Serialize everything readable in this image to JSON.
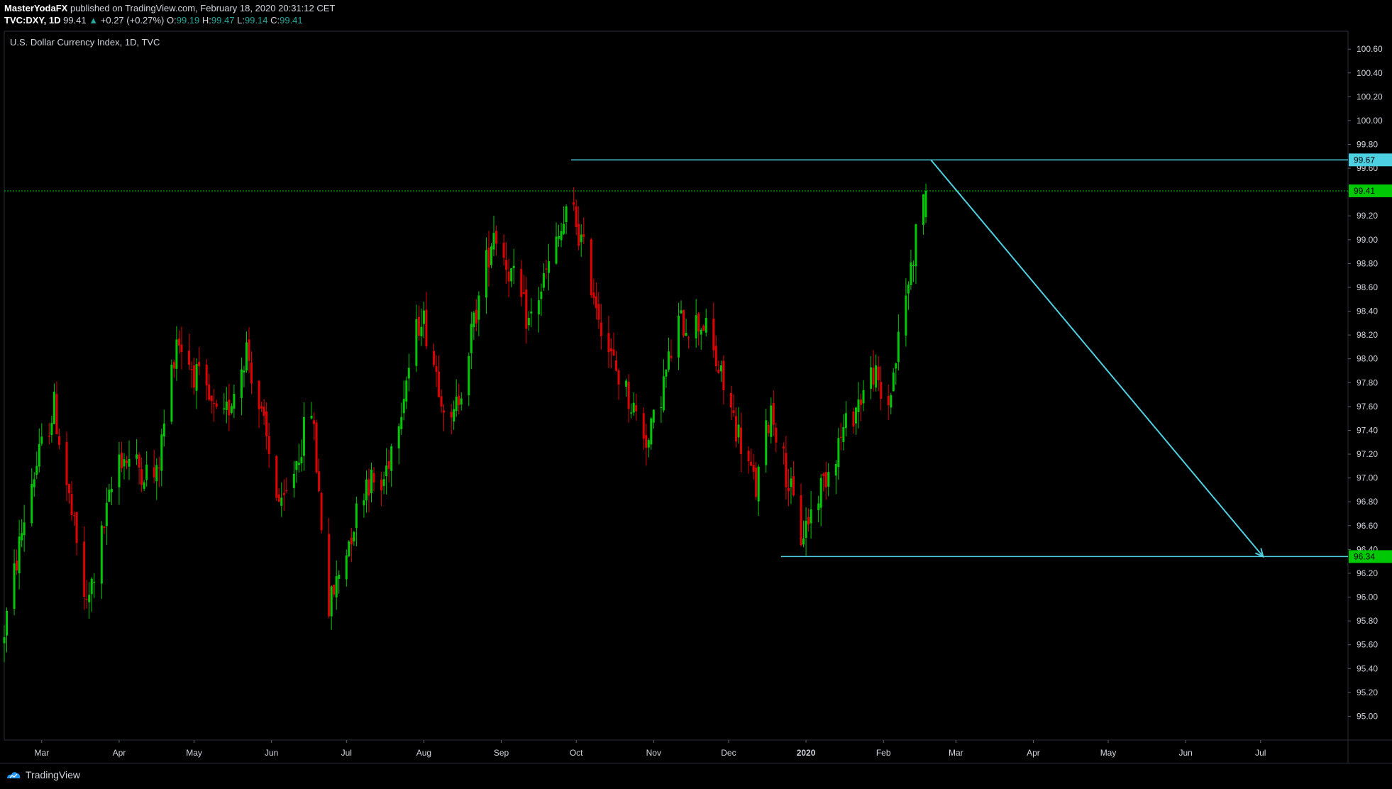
{
  "header": {
    "author": "MasterYodaFX",
    "published_text": "published on TradingView.com, February 18, 2020 20:31:12 CET",
    "symbol": "TVC:DXY, 1D",
    "last": "99.41",
    "change_icon": "triangle-up-icon",
    "change": "+0.27 (+0.27%)",
    "open_label": "O:",
    "open": "99.19",
    "high_label": "H:",
    "high": "99.47",
    "low_label": "L:",
    "low": "99.14",
    "close_label": "C:",
    "close": "99.41"
  },
  "footer": {
    "brand": "TradingView",
    "icon": "tradingview-logo-icon"
  },
  "colors": {
    "background": "#000000",
    "up": "#00c805",
    "down": "#e00000",
    "line": "#4dd0e1",
    "price_line": "#00c805",
    "grid_border": "#2a2e39"
  },
  "chart_data": {
    "type": "candlestick",
    "title": "U.S. Dollar Currency Index, 1D, TVC",
    "ylim": [
      94.8,
      100.75
    ],
    "y_ticks": [
      "100.60",
      "100.40",
      "100.20",
      "100.00",
      "99.80",
      "99.60",
      "99.40",
      "99.20",
      "99.00",
      "98.80",
      "98.60",
      "98.40",
      "98.20",
      "98.00",
      "97.80",
      "97.60",
      "97.40",
      "97.20",
      "97.00",
      "96.80",
      "96.60",
      "96.40",
      "96.20",
      "96.00",
      "95.80",
      "95.60",
      "95.40",
      "95.20",
      "95.00"
    ],
    "x_ticks": [
      "Mar",
      "Apr",
      "May",
      "Jun",
      "Jul",
      "Aug",
      "Sep",
      "Oct",
      "Nov",
      "Dec",
      "2020",
      "Feb",
      "Mar",
      "Apr",
      "May",
      "Jun",
      "Jul"
    ],
    "x_start": "2019-02-14",
    "x_end": "2020-08-05",
    "x_tick_dates": [
      "2019-03-01",
      "2019-04-01",
      "2019-05-01",
      "2019-06-01",
      "2019-07-01",
      "2019-08-01",
      "2019-09-01",
      "2019-10-01",
      "2019-11-01",
      "2019-12-01",
      "2020-01-01",
      "2020-02-01",
      "2020-03-01",
      "2020-04-01",
      "2020-05-01",
      "2020-06-01",
      "2020-07-01"
    ],
    "price_tags": [
      {
        "label": "99.67",
        "value": 99.67,
        "color": "#4dd0e1"
      },
      {
        "label": "99.41",
        "value": 99.41,
        "color": "#00c805"
      },
      {
        "label": "96.34",
        "value": 96.34,
        "color": "#00c805"
      }
    ],
    "last_price": 99.41,
    "anchors": [
      [
        "2019-02-14",
        95.6
      ],
      [
        "2019-02-25",
        96.9
      ],
      [
        "2019-03-07",
        97.6
      ],
      [
        "2019-03-20",
        95.9
      ],
      [
        "2019-04-02",
        97.2
      ],
      [
        "2019-04-17",
        97.0
      ],
      [
        "2019-04-25",
        98.2
      ],
      [
        "2019-05-13",
        97.4
      ],
      [
        "2019-05-23",
        98.1
      ],
      [
        "2019-06-06",
        96.7
      ],
      [
        "2019-06-18",
        97.6
      ],
      [
        "2019-06-25",
        95.9
      ],
      [
        "2019-07-10",
        97.0
      ],
      [
        "2019-07-16",
        96.9
      ],
      [
        "2019-08-01",
        98.4
      ],
      [
        "2019-08-13",
        97.4
      ],
      [
        "2019-08-30",
        99.1
      ],
      [
        "2019-09-13",
        98.3
      ],
      [
        "2019-09-30",
        99.3
      ],
      [
        "2019-10-16",
        98.0
      ],
      [
        "2019-10-31",
        97.3
      ],
      [
        "2019-11-12",
        98.3
      ],
      [
        "2019-11-22",
        98.3
      ],
      [
        "2019-12-13",
        96.9
      ],
      [
        "2019-12-19",
        97.6
      ],
      [
        "2019-12-31",
        96.5
      ],
      [
        "2020-01-15",
        97.3
      ],
      [
        "2020-01-29",
        97.9
      ],
      [
        "2020-02-03",
        97.5
      ],
      [
        "2020-02-18",
        99.41
      ]
    ],
    "resistance_line": {
      "from": [
        "2019-09-29",
        99.67
      ],
      "to": [
        "2020-08-05",
        99.67
      ]
    },
    "support_line": {
      "from": [
        "2019-12-22",
        96.34
      ],
      "to": [
        "2020-08-05",
        96.34
      ]
    },
    "projection_arrow": {
      "from": [
        "2020-02-20",
        99.67
      ],
      "to": [
        "2020-07-02",
        96.34
      ]
    }
  }
}
